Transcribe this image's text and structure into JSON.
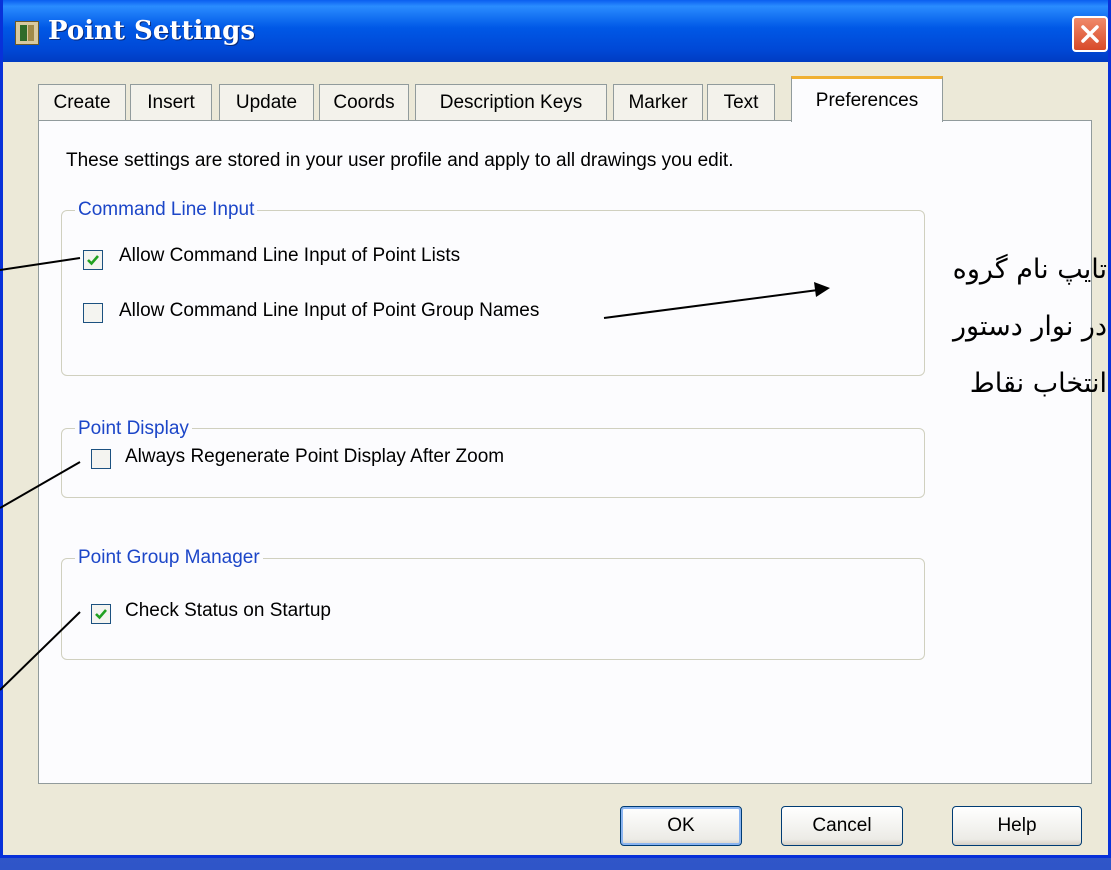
{
  "window": {
    "title": "Point Settings"
  },
  "tabs": [
    {
      "label": "Create",
      "active": false
    },
    {
      "label": "Insert",
      "active": false
    },
    {
      "label": "Update",
      "active": false
    },
    {
      "label": "Coords",
      "active": false
    },
    {
      "label": "Description Keys",
      "active": false
    },
    {
      "label": "Marker",
      "active": false
    },
    {
      "label": "Text",
      "active": false
    },
    {
      "label": "Preferences",
      "active": true
    }
  ],
  "preferences": {
    "intro": "These settings are stored in your user profile and apply to all drawings you edit.",
    "groups": [
      {
        "title": "Command Line Input",
        "options": [
          {
            "label": "Allow Command Line Input of Point Lists",
            "checked": true
          },
          {
            "label": "Allow Command Line Input of Point Group Names",
            "checked": false
          }
        ]
      },
      {
        "title": "Point Display",
        "options": [
          {
            "label": "Always Regenerate Point Display After Zoom",
            "checked": false
          }
        ]
      },
      {
        "title": "Point Group Manager",
        "options": [
          {
            "label": "Check Status on Startup",
            "checked": true
          }
        ]
      }
    ]
  },
  "buttons": {
    "ok": "OK",
    "cancel": "Cancel",
    "help": "Help"
  },
  "annotation": {
    "lines": [
      "تایپ نام گروه",
      "در نوار دستور",
      "انتخاب نقاط"
    ]
  },
  "colors": {
    "titlebar": "#0058e6",
    "group_title": "#1c46c8",
    "active_tab_accent": "#f0b032",
    "checkmark": "#21a121"
  }
}
